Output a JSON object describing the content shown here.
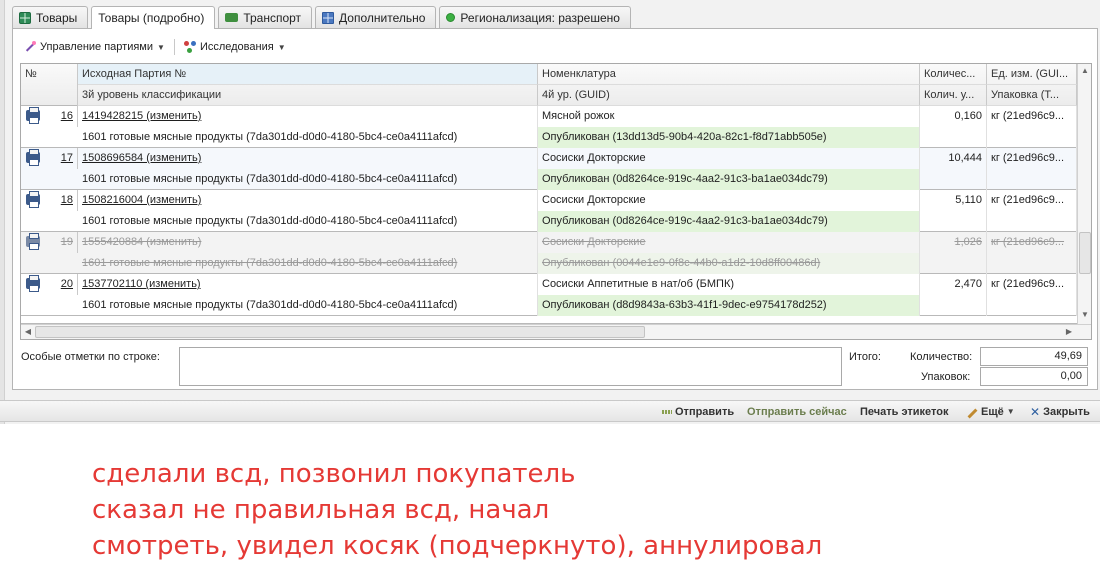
{
  "tabs": [
    {
      "label": "Товары",
      "icon": "grid-icon"
    },
    {
      "label": "Товары (подробно)",
      "icon": ""
    },
    {
      "label": "Транспорт",
      "icon": "truck-icon"
    },
    {
      "label": "Дополнительно",
      "icon": "table-icon"
    },
    {
      "label": "Регионализация: разрешено",
      "icon": "status-dot-icon"
    }
  ],
  "toolbar": {
    "batches_label": "Управление партиями",
    "research_label": "Исследования"
  },
  "table": {
    "headers": {
      "num": "№",
      "batch": "Исходная Партия №",
      "nomenclature": "Номенклатура",
      "qty": "Количес...",
      "unit": "Ед. изм. (GUI...",
      "class3": "3й уровень классификации",
      "guid4": "4й ур. (GUID)",
      "qty_unit": "Колич. у...",
      "package": "Упаковка (Т..."
    },
    "rows": [
      {
        "num": "16",
        "batch": "1419428215 (изменить)",
        "product": "Мясной рожок",
        "qty": "0,160",
        "unit": "кг (21ed96c9...",
        "classification": "1601 готовые мясные продукты (7da301dd-d0d0-4180-5bc4-ce0a4111afcd)",
        "status": "Опубликован (13dd13d5-90b4-420a-82c1-f8d71abb505e)",
        "cancelled": false
      },
      {
        "num": "17",
        "batch": "1508696584 (изменить)",
        "product": "Сосиски Докторские",
        "qty": "10,444",
        "unit": "кг (21ed96c9...",
        "classification": "1601 готовые мясные продукты (7da301dd-d0d0-4180-5bc4-ce0a4111afcd)",
        "status": "Опубликован (0d8264ce-919c-4aa2-91c3-ba1ae034dc79)",
        "cancelled": false
      },
      {
        "num": "18",
        "batch": "1508216004 (изменить)",
        "product": "Сосиски Докторские",
        "qty": "5,110",
        "unit": "кг (21ed96c9...",
        "classification": "1601 готовые мясные продукты (7da301dd-d0d0-4180-5bc4-ce0a4111afcd)",
        "status": "Опубликован (0d8264ce-919c-4aa2-91c3-ba1ae034dc79)",
        "cancelled": false
      },
      {
        "num": "19",
        "batch": "1555420884 (изменить)",
        "product": "Сосиски Докторские",
        "qty": "1,026",
        "unit": "кг (21ed96c9...",
        "classification": "1601 готовые мясные продукты (7da301dd-d0d0-4180-5bc4-ce0a4111afcd)",
        "status": "Опубликован (0044e1e9-0f8c-44b0-a1d2-10d8ff00486d)",
        "cancelled": true
      },
      {
        "num": "20",
        "batch": "1537702110 (изменить)",
        "product": "Сосиски Аппетитные в нат/об (БМПК)",
        "qty": "2,470",
        "unit": "кг (21ed96c9...",
        "classification": "1601 готовые мясные продукты (7da301dd-d0d0-4180-5bc4-ce0a4111afcd)",
        "status": "Опубликован (d8d9843a-63b3-41f1-9dec-e9754178d252)",
        "cancelled": false
      }
    ]
  },
  "footer": {
    "notes_label": "Особые отметки по строке:",
    "total_label": "Итого:",
    "qty_label": "Количество:",
    "qty_value": "49,69",
    "pack_label": "Упаковок:",
    "pack_value": "0,00"
  },
  "commands": {
    "send": "Отправить",
    "send_now": "Отправить сейчас",
    "print_labels": "Печать этикеток",
    "more": "Ещё",
    "close": "Закрыть"
  },
  "annotation": [
    "сделали всд, позвонил покупатель",
    "сказал не правильная всд, начал",
    "смотреть, увидел косяк (подчеркнуто), аннулировал"
  ],
  "colors": {
    "annotation": "#e53935",
    "published_cell": "#e2f4da",
    "highlight_mark": "#f3e36a"
  }
}
